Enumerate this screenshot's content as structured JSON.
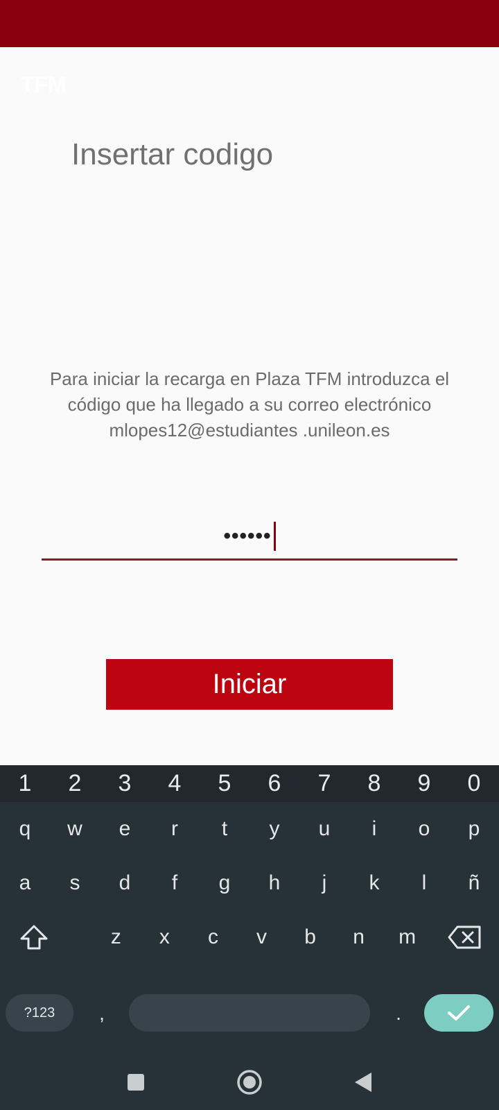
{
  "app": {
    "title": "TFM"
  },
  "page": {
    "heading": "Insertar codigo",
    "instructions": "Para iniciar la recarga en Plaza TFM introduzca el código que ha llegado a su correo electrónico mlopes12@estudiantes .unileon.es"
  },
  "code_input": {
    "value": "••••••"
  },
  "start_button": {
    "label": "Iniciar"
  },
  "colors": {
    "status_bar": "#8b000d",
    "button": "#bb0410",
    "keyboard_bg": "#263238",
    "enter_key": "#7dcdc2"
  },
  "keyboard": {
    "numbers": [
      "1",
      "2",
      "3",
      "4",
      "5",
      "6",
      "7",
      "8",
      "9",
      "0"
    ],
    "row1": [
      "q",
      "w",
      "e",
      "r",
      "t",
      "y",
      "u",
      "i",
      "o",
      "p"
    ],
    "row2": [
      "a",
      "s",
      "d",
      "f",
      "g",
      "h",
      "j",
      "k",
      "l",
      "ñ"
    ],
    "row3": [
      "z",
      "x",
      "c",
      "v",
      "b",
      "n",
      "m"
    ],
    "symbols_label": "?123",
    "comma": ",",
    "period": ".",
    "icons": {
      "shift": "shift-icon",
      "backspace": "backspace-icon",
      "enter": "check-icon"
    }
  },
  "nav_bar": {
    "icons": [
      "recents-icon",
      "home-icon",
      "back-icon"
    ]
  }
}
